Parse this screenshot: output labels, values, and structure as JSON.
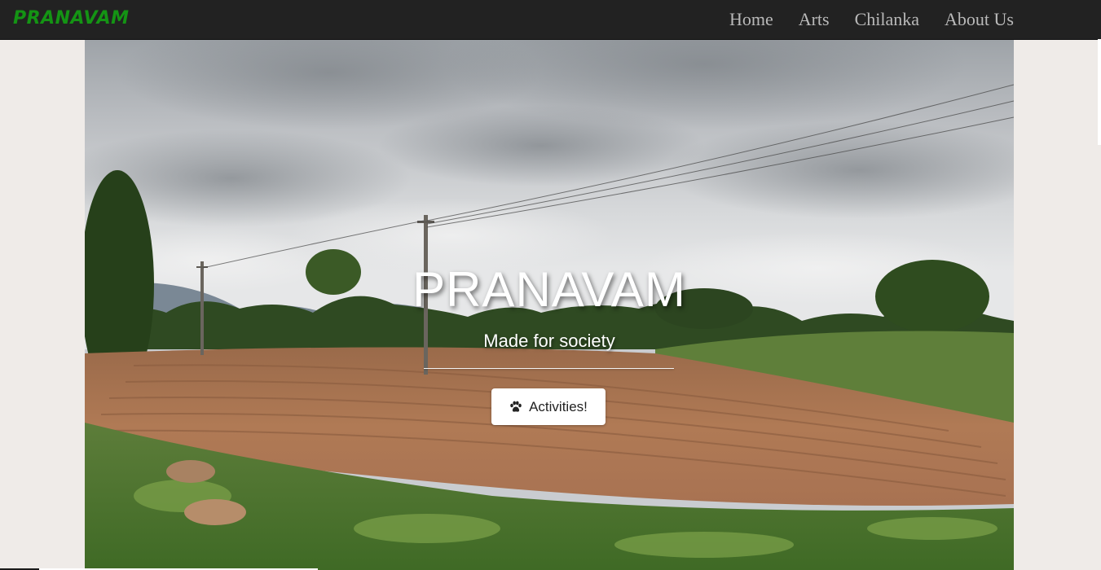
{
  "navbar": {
    "brand": "PRANAVAM",
    "links": [
      "Home",
      "Arts",
      "Chilanka",
      "About Us"
    ]
  },
  "hero": {
    "title": "PRANAVAM",
    "subtitle": "Made for society",
    "button_label": "Activities!",
    "button_icon": "paw-icon",
    "background": "landscape-photo"
  },
  "colors": {
    "navbar_bg": "#222222",
    "brand": "#149414",
    "nav_link": "#b9b9b9",
    "page_bg": "#efebe8"
  }
}
